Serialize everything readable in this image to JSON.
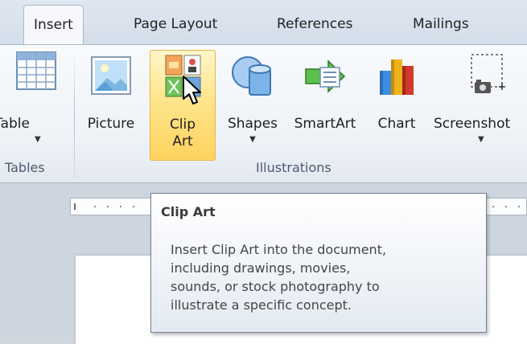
{
  "tabs": [
    {
      "label": "Insert",
      "active": true
    },
    {
      "label": "Page Layout",
      "active": false
    },
    {
      "label": "References",
      "active": false
    },
    {
      "label": "Mailings",
      "active": false
    }
  ],
  "groups": {
    "tables": {
      "label": "Tables",
      "buttons": [
        {
          "label": "Table",
          "icon": "table-icon",
          "has_dropdown": true
        }
      ]
    },
    "illustrations": {
      "label": "Illustrations",
      "buttons": [
        {
          "label": "Picture",
          "icon": "picture-icon",
          "has_dropdown": false
        },
        {
          "label_line1": "Clip",
          "label_line2": "Art",
          "icon": "clip-art-icon",
          "has_dropdown": false,
          "hovered": true
        },
        {
          "label": "Shapes",
          "icon": "shapes-icon",
          "has_dropdown": true
        },
        {
          "label": "SmartArt",
          "icon": "smartart-icon",
          "has_dropdown": false
        },
        {
          "label": "Chart",
          "icon": "chart-icon",
          "has_dropdown": false
        },
        {
          "label": "Screenshot",
          "icon": "screenshot-icon",
          "has_dropdown": true
        }
      ]
    }
  },
  "tooltip": {
    "title": "Clip Art",
    "line1": "Insert Clip Art into the document,",
    "line2": "including drawings, movies,",
    "line3": "sounds, or stock photography to",
    "line4": "illustrate a specific concept."
  },
  "colors": {
    "hover_fill": "#ffe58c",
    "hover_border": "#e3b648",
    "ribbon_bg": "#eef2f7",
    "tab_strip_bg": "#dbe4ef",
    "document_bg": "#cdd5de"
  }
}
